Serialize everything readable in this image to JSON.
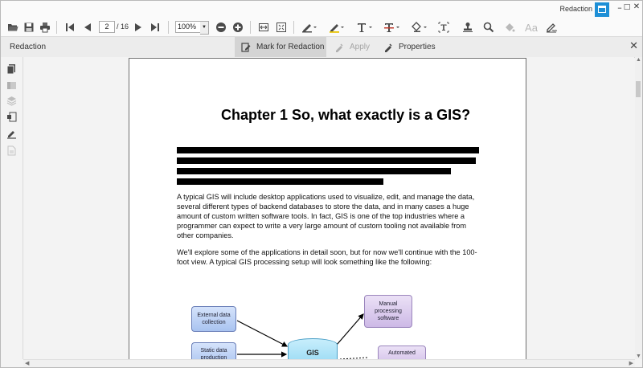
{
  "window": {
    "title": "Redaction",
    "controls": [
      "–",
      "□",
      "✕"
    ]
  },
  "toolbar": {
    "page_current": "2",
    "page_total": "/ 16",
    "zoom": "100%",
    "icons": [
      "open-folder-icon",
      "save-icon",
      "print-icon",
      "first-page-icon",
      "prev-page-icon",
      "next-page-icon",
      "last-page-icon",
      "zoom-out-icon",
      "zoom-in-icon",
      "fit-width-icon",
      "fit-page-icon",
      "pen-icon",
      "highlighter-icon",
      "text-icon",
      "strikeout-icon",
      "shape-icon",
      "textbox-icon",
      "stamp-icon",
      "search-icon",
      "fill-icon",
      "font-icon",
      "signature-icon"
    ]
  },
  "redaction_panel": {
    "title": "Redaction",
    "mark_label": "Mark for Redaction",
    "apply_label": "Apply",
    "properties_label": "Properties",
    "close": "✕"
  },
  "document": {
    "chapter_title": "Chapter 1  So, what exactly is a GIS?",
    "paragraph1": "A typical GIS will include desktop applications used to visualize, edit, and manage the data, several different types of backend databases to store the data, and in many cases a huge amount of custom written software tools. In fact, GIS is one of the top industries where a programmer can expect to write a very large amount of custom tooling not available from other companies.",
    "paragraph2": "We'll explore some of the applications in detail soon, but for now we'll continue with the 100-foot view. A typical GIS processing setup will look something like the following:",
    "diagram": {
      "external": "External data collection",
      "static": "Static data production",
      "manual": "Manual processing software",
      "automated": "Automated",
      "gis": "GIS"
    }
  },
  "colors": {
    "accent": "#1e8fd6",
    "redaction": "#000000",
    "active_tab": "#d4d4d4"
  }
}
